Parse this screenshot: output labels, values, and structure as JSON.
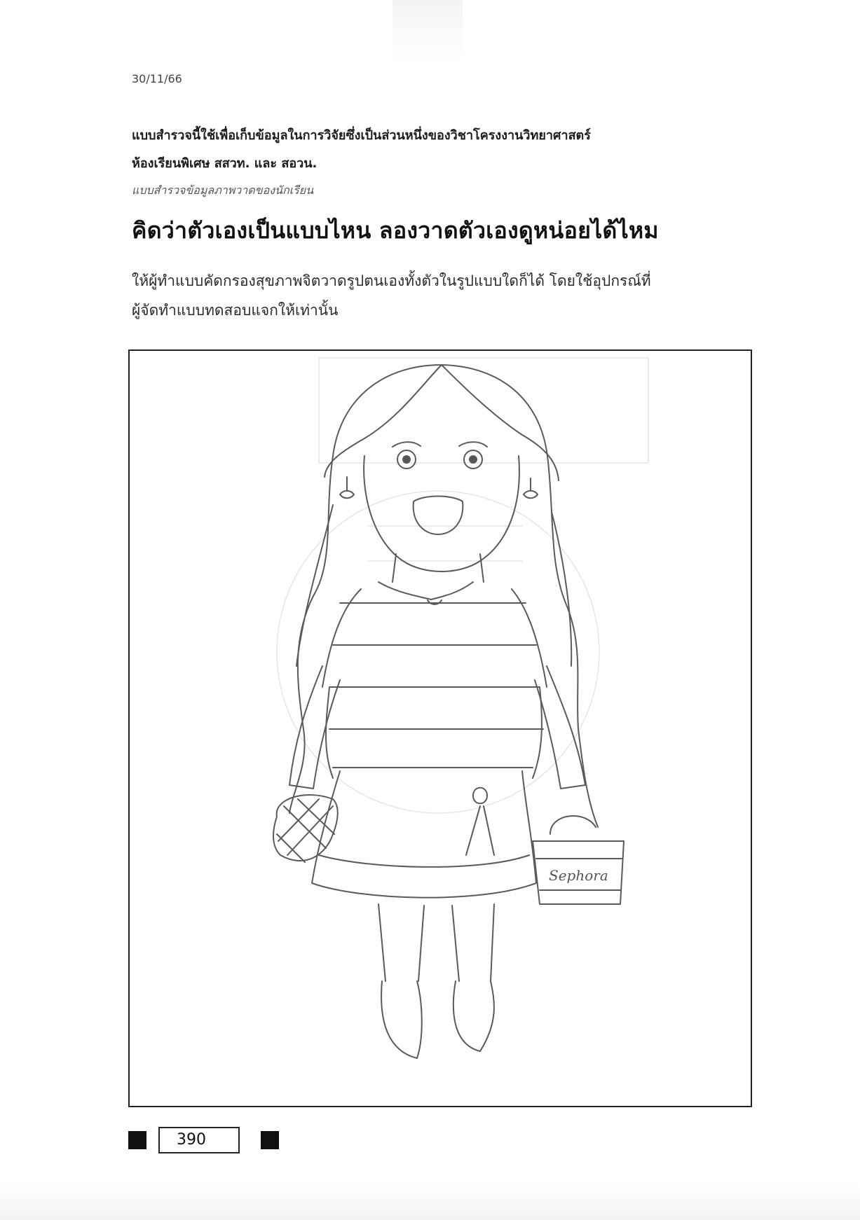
{
  "header": {
    "date": "30/11/66"
  },
  "form": {
    "intro_line1": "แบบสำรวจนี้ใช้เพื่อเก็บข้อมูลในการวิจัยซึ่งเป็นส่วนหนึ่งของวิชาโครงงานวิทยาศาสตร์",
    "intro_line2": "ห้องเรียนพิเศษ สสวท. และ สอวน.",
    "subtitle": "แบบสำรวจข้อมูลภาพวาดของนักเรียน",
    "heading": "คิดว่าตัวเองเป็นแบบไหน ลองวาดตัวเองดูหน่อยได้ไหม",
    "instruction_line1": "ให้ผู้ทำแบบคัดกรองสุขภาพจิตวาดรูปตนเองทั้งตัวในรูปแบบใดก็ได้ โดยใช้อุปกรณ์ที่",
    "instruction_line2": "ผู้จัดทำแบบทดสอบแจกให้เท่านั้น"
  },
  "drawing": {
    "bag_label": "Sephora"
  },
  "footer": {
    "sheet_number": "390"
  }
}
